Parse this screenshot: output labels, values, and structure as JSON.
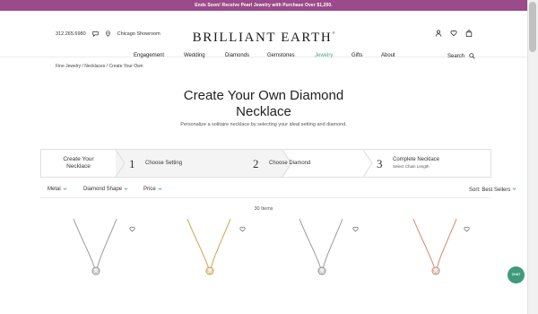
{
  "promo": {
    "text": "Ends Soon! Receive Pearl Jewelry with Purchase Over $1,200."
  },
  "header": {
    "phone": "312.265.6980",
    "showroom": "Chicago Showroom",
    "logo": "BRILLIANT EARTH",
    "logo_mark": "®",
    "icons": [
      "chat-bubble-icon",
      "location-pin-icon",
      "user-icon",
      "heart-icon",
      "bag-icon"
    ]
  },
  "nav": {
    "items": [
      "Engagement",
      "Wedding",
      "Diamonds",
      "Gemstones",
      "Jewelry",
      "Gifts",
      "About"
    ],
    "active": "Jewelry",
    "search_label": "Search"
  },
  "breadcrumb": "Fine Jewelry / Necklaces / Create Your Own",
  "page": {
    "title_line1": "Create Your Own Diamond",
    "title_line2": "Necklace",
    "subtitle": "Personalize a solitaire necklace by selecting your ideal setting and diamond."
  },
  "steps": {
    "intro_line1": "Create Your",
    "intro_line2": "Necklace",
    "items": [
      {
        "num": "1",
        "label": "Choose Setting",
        "sub": ""
      },
      {
        "num": "2",
        "label": "Choose Diamond",
        "sub": ""
      },
      {
        "num": "3",
        "label": "Complete Necklace",
        "sub": "Select Chain Length"
      }
    ]
  },
  "filters": {
    "items": [
      "Metal",
      "Diamond Shape",
      "Price"
    ],
    "sort": "Sort: Best Sellers"
  },
  "results": {
    "count": "30 Items"
  },
  "products": [
    {
      "metal": "white gold",
      "chain_color": "#9a9a9a"
    },
    {
      "metal": "yellow gold",
      "chain_color": "#d2a24a"
    },
    {
      "metal": "white gold",
      "chain_color": "#9a9a9a"
    },
    {
      "metal": "rose gold",
      "chain_color": "#d08a68"
    }
  ],
  "chat": {
    "label": "CHAT"
  },
  "colors": {
    "promo": "#9b4a8a",
    "accent": "#4aa88c",
    "chat": "#3f9a7c"
  }
}
